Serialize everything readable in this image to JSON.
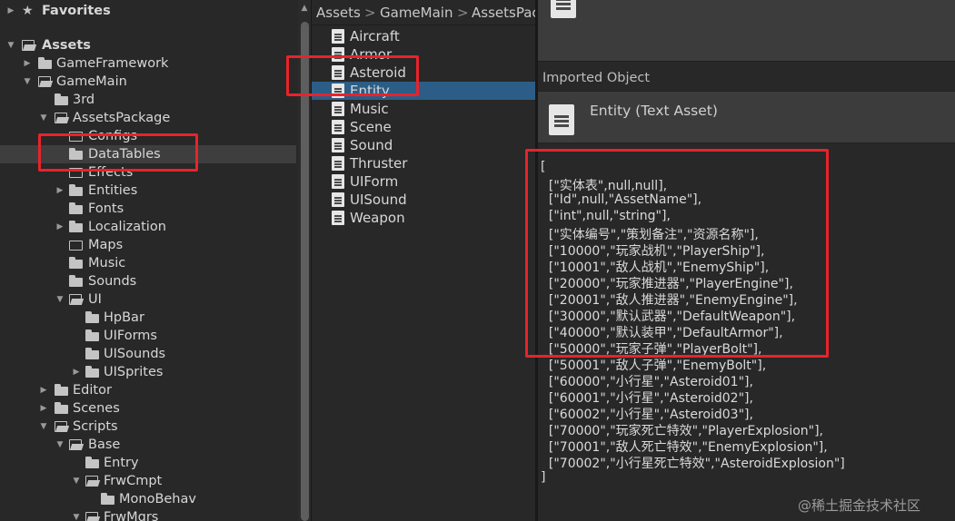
{
  "tree": {
    "favorites_label": "Favorites",
    "assets_label": "Assets",
    "items": [
      {
        "label": "GameFramework"
      },
      {
        "label": "GameMain"
      },
      {
        "label": "3rd"
      },
      {
        "label": "AssetsPackage"
      },
      {
        "label": "Configs"
      },
      {
        "label": "DataTables"
      },
      {
        "label": "Effects"
      },
      {
        "label": "Entities"
      },
      {
        "label": "Fonts"
      },
      {
        "label": "Localization"
      },
      {
        "label": "Maps"
      },
      {
        "label": "Music"
      },
      {
        "label": "Sounds"
      },
      {
        "label": "UI"
      },
      {
        "label": "HpBar"
      },
      {
        "label": "UIForms"
      },
      {
        "label": "UISounds"
      },
      {
        "label": "UISprites"
      },
      {
        "label": "Editor"
      },
      {
        "label": "Scenes"
      },
      {
        "label": "Scripts"
      },
      {
        "label": "Base"
      },
      {
        "label": "Entry"
      },
      {
        "label": "FrwCmpt"
      },
      {
        "label": "MonoBehav"
      },
      {
        "label": "FrwMgrs"
      }
    ]
  },
  "breadcrumb": [
    "Assets",
    "GameMain",
    "AssetsPac"
  ],
  "files": [
    "Aircraft",
    "Armor",
    "Asteroid",
    "Entity",
    "Music",
    "Scene",
    "Sound",
    "Thruster",
    "UIForm",
    "UISound",
    "Weapon"
  ],
  "inspector": {
    "imported_label": "Imported Object",
    "asset_title": "Entity (Text Asset)",
    "lines": [
      "[",
      "  [\"实体表\",null,null],",
      "  [\"Id\",null,\"AssetName\"],",
      "  [\"int\",null,\"string\"],",
      "  [\"实体编号\",\"策划备注\",\"资源名称\"],",
      "  [\"10000\",\"玩家战机\",\"PlayerShip\"],",
      "  [\"10001\",\"敌人战机\",\"EnemyShip\"],",
      "  [\"20000\",\"玩家推进器\",\"PlayerEngine\"],",
      "  [\"20001\",\"敌人推进器\",\"EnemyEngine\"],",
      "  [\"30000\",\"默认武器\",\"DefaultWeapon\"],",
      "  [\"40000\",\"默认装甲\",\"DefaultArmor\"],",
      "  [\"50000\",\"玩家子弹\",\"PlayerBolt\"],",
      "  [\"50001\",\"敌人子弹\",\"EnemyBolt\"],",
      "  [\"60000\",\"小行星\",\"Asteroid01\"],",
      "  [\"60001\",\"小行星\",\"Asteroid02\"],",
      "  [\"60002\",\"小行星\",\"Asteroid03\"],",
      "  [\"70000\",\"玩家死亡特效\",\"PlayerExplosion\"],",
      "  [\"70001\",\"敌人死亡特效\",\"EnemyExplosion\"],",
      "  [\"70002\",\"小行星死亡特效\",\"AsteroidExplosion\"]",
      "]"
    ]
  },
  "watermark": "@稀土掘金技术社区",
  "colors": {
    "highlight": "#e8232b",
    "selected": "#2c5d87"
  }
}
